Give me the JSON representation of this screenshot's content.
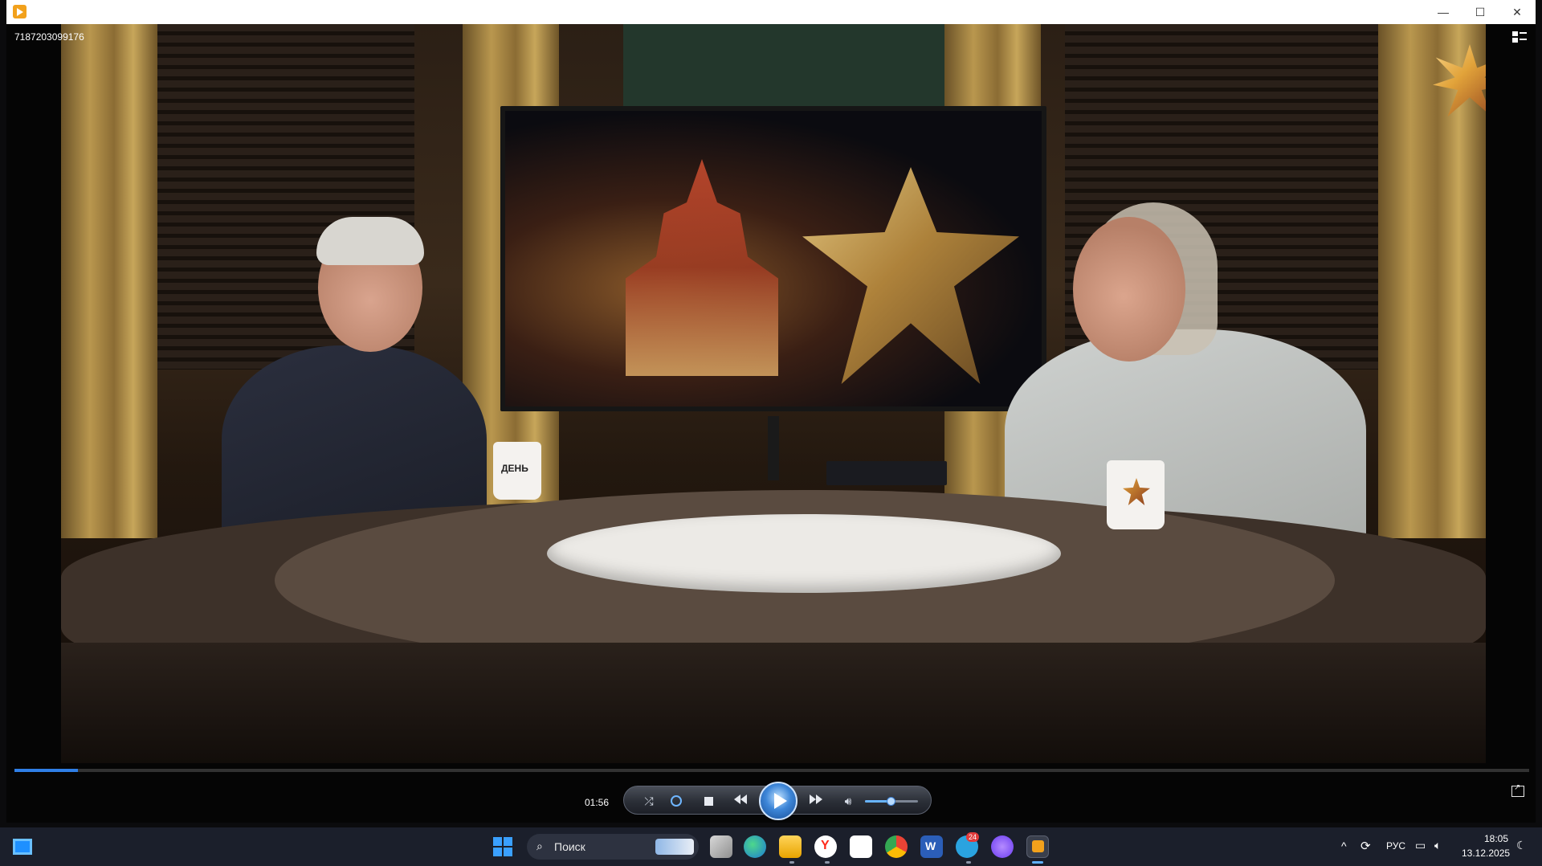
{
  "window": {
    "video_title": "7187203099176",
    "minimize": "—",
    "maximize": "☐",
    "close": "✕"
  },
  "video": {
    "mug_label": "ДЕНЬ",
    "progress_fraction": 0.042
  },
  "controls": {
    "current_time": "01:56",
    "volume_fraction": 0.5,
    "state": "paused"
  },
  "taskbar": {
    "search_placeholder": "Поиск",
    "telegram_badge": "24",
    "language": "РУС",
    "time": "18:05",
    "date": "13.12.2025"
  },
  "colors": {
    "accent": "#2f7fe6",
    "taskbar": "#1b1f2b",
    "play_button": "#3d86d8"
  },
  "icons": [
    "app-icon",
    "playlist-icon",
    "shuffle-icon",
    "repeat-icon",
    "stop-icon",
    "previous-icon",
    "play-icon",
    "next-icon",
    "volume-icon",
    "switch-to-library-icon",
    "start-icon",
    "search-icon",
    "task-view-icon",
    "edge-icon",
    "explorer-icon",
    "yandex-browser-icon",
    "store-icon",
    "chrome-icon",
    "word-icon",
    "telegram-icon",
    "alice-icon",
    "media-player-icon",
    "tray-chevron-icon",
    "sync-icon",
    "network-icon",
    "speaker-icon",
    "notification-icon"
  ]
}
